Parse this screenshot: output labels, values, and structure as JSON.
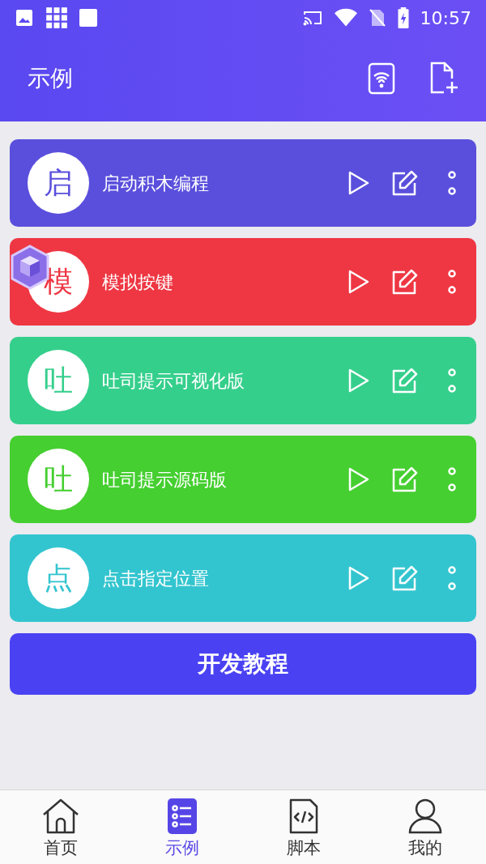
{
  "status_bar": {
    "time": "10:57"
  },
  "header": {
    "title": "示例"
  },
  "cards": [
    {
      "badge": "启",
      "title": "启动积木编程",
      "color": "#5a4fdc"
    },
    {
      "badge": "模",
      "title": "模拟按键",
      "color": "#ee3743"
    },
    {
      "badge": "吐",
      "title": "吐司提示可视化版",
      "color": "#35cf8c"
    },
    {
      "badge": "吐",
      "title": "吐司提示源码版",
      "color": "#45cf30"
    },
    {
      "badge": "点",
      "title": "点击指定位置",
      "color": "#33c5cf"
    }
  ],
  "tutorial_button": {
    "label": "开发教程"
  },
  "bottom_nav": [
    {
      "kind": "home",
      "label": "首页",
      "selected": false
    },
    {
      "kind": "list",
      "label": "示例",
      "selected": true
    },
    {
      "kind": "code",
      "label": "脚本",
      "selected": false
    },
    {
      "kind": "user",
      "label": "我的",
      "selected": false
    }
  ]
}
